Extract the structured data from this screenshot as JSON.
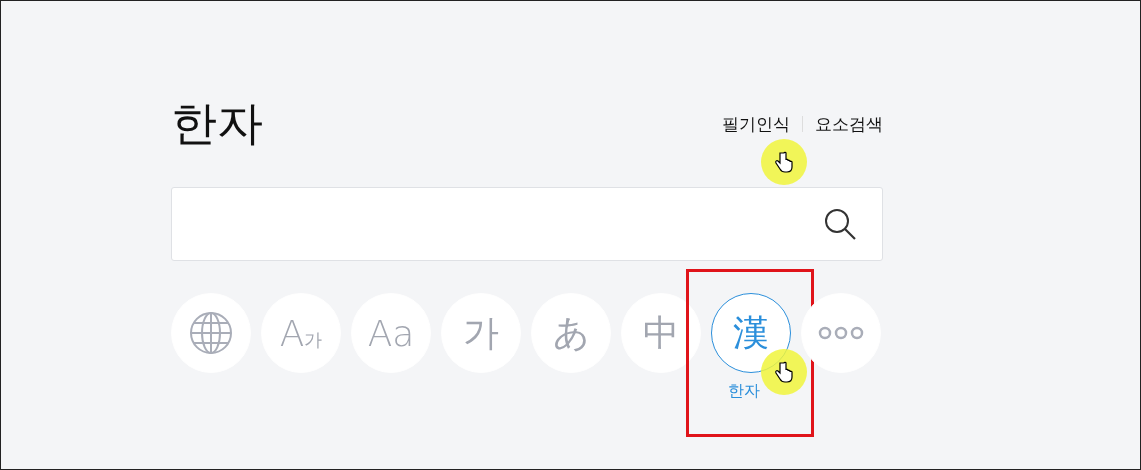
{
  "title": "한자",
  "links": [
    {
      "label": "필기인식"
    },
    {
      "label": "요소검색"
    }
  ],
  "input_modes": [
    {
      "kind": "globe",
      "selected": false
    },
    {
      "kind": "glyph",
      "text": "A$_{가}$",
      "selected": false
    },
    {
      "kind": "glyph",
      "text": "Aa",
      "selected": false
    },
    {
      "kind": "glyph",
      "text": "가",
      "selected": false
    },
    {
      "kind": "glyph",
      "text": "あ",
      "selected": false
    },
    {
      "kind": "glyph",
      "text": "中",
      "selected": false
    },
    {
      "kind": "glyph",
      "text": "漢",
      "selected": true,
      "label": "한자"
    },
    {
      "kind": "more",
      "selected": false
    }
  ]
}
